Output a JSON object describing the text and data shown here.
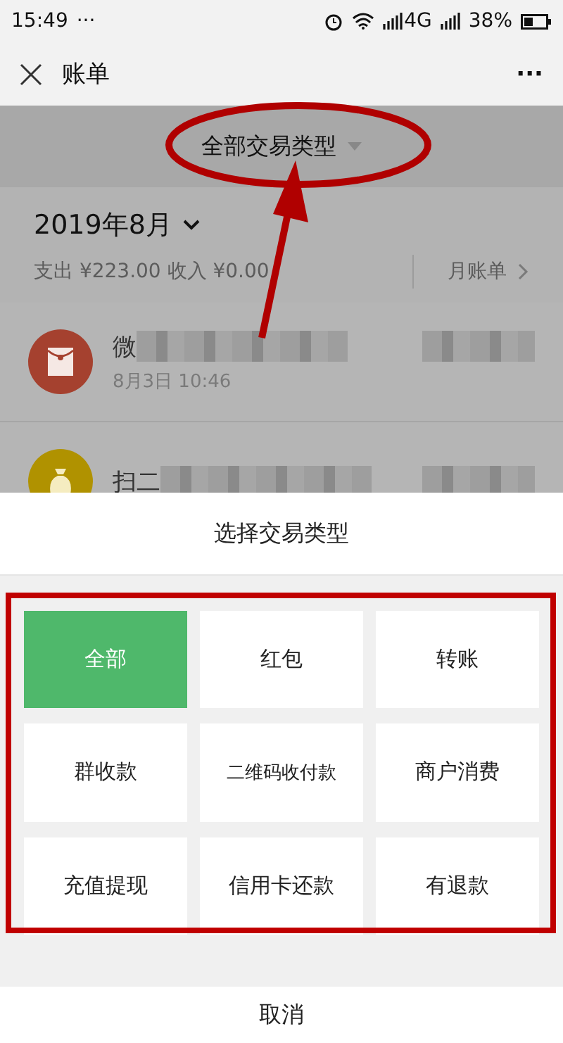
{
  "status_bar": {
    "time": "15:49",
    "dots": "···",
    "network": "4G",
    "battery": "38%"
  },
  "header": {
    "title": "账单",
    "more": "···"
  },
  "filter": {
    "label": "全部交易类型"
  },
  "month": {
    "title": "2019年8月",
    "summary": "支出 ¥223.00 收入 ¥0.00",
    "monthly_bill": "月账单"
  },
  "transactions": [
    {
      "kind": "redpacket",
      "title": "微",
      "time": "8月3日 10:46",
      "color": "#a5412f"
    },
    {
      "kind": "money",
      "title": "扫二",
      "color": "#b09200"
    }
  ],
  "sheet": {
    "title": "选择交易类型",
    "options": [
      {
        "label": "全部",
        "selected": true
      },
      {
        "label": "红包",
        "selected": false
      },
      {
        "label": "转账",
        "selected": false
      },
      {
        "label": "群收款",
        "selected": false
      },
      {
        "label": "二维码收付款",
        "selected": false
      },
      {
        "label": "商户消费",
        "selected": false
      },
      {
        "label": "充值提现",
        "selected": false
      },
      {
        "label": "信用卡还款",
        "selected": false
      },
      {
        "label": "有退款",
        "selected": false
      }
    ],
    "cancel": "取消"
  }
}
